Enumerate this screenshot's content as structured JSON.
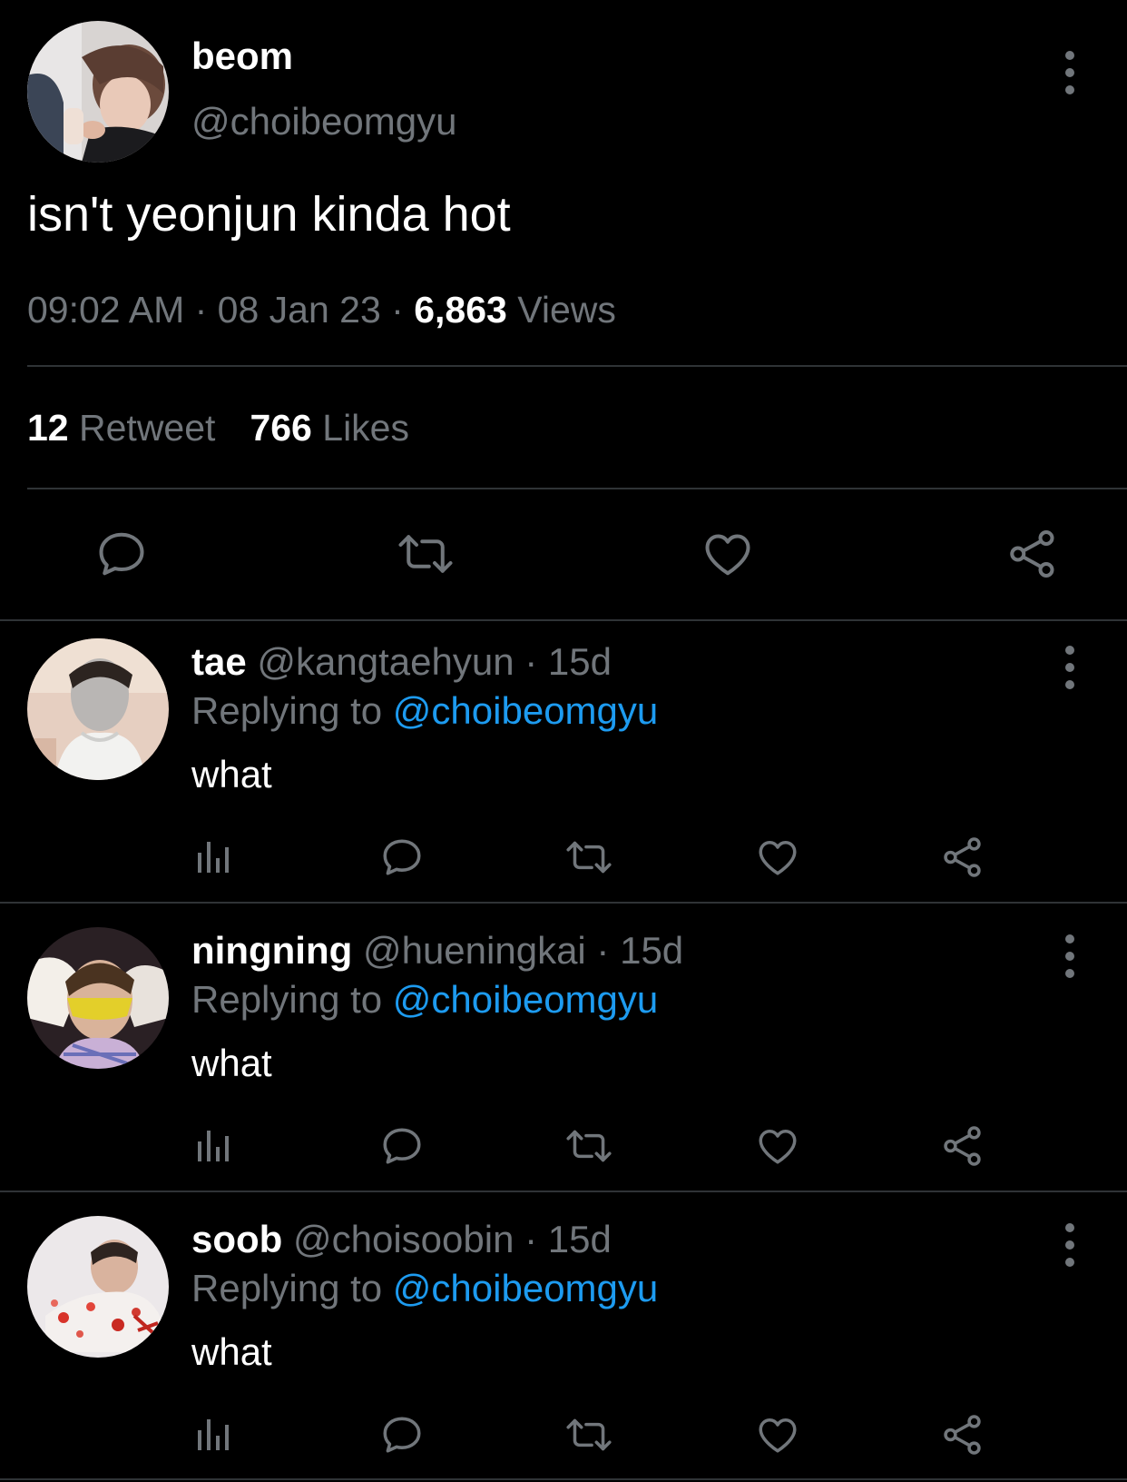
{
  "main_tweet": {
    "name": "beom",
    "handle": "@choibeomgyu",
    "text": "isn't yeonjun kinda hot",
    "time": "09:02 AM",
    "date": "08 Jan 23",
    "views_count": "6,863",
    "views_label": "Views",
    "retweet_count": "12",
    "retweet_label": "Retweet",
    "likes_count": "766",
    "likes_label": "Likes"
  },
  "replies": [
    {
      "name": "tae",
      "handle": "@kangtaehyun",
      "age": "15d",
      "replying_prefix": "Replying to",
      "replying_to": "@choibeomgyu",
      "text": "what"
    },
    {
      "name": "ningning",
      "handle": "@hueningkai",
      "age": "15d",
      "replying_prefix": "Replying to",
      "replying_to": "@choibeomgyu",
      "text": "what"
    },
    {
      "name": "soob",
      "handle": "@choisoobin",
      "age": "15d",
      "replying_prefix": "Replying to",
      "replying_to": "@choibeomgyu",
      "text": "what"
    }
  ],
  "colors": {
    "background": "#000000",
    "text": "#ffffff",
    "secondary": "#71767b",
    "link": "#1d9bf0",
    "divider": "#2f3336"
  },
  "icons": [
    "reply-icon",
    "retweet-icon",
    "like-icon",
    "share-icon",
    "views-icon",
    "more-icon"
  ]
}
